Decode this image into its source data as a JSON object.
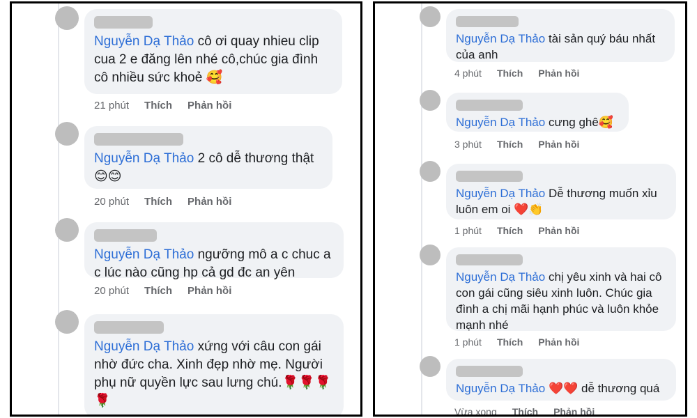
{
  "left_panel": {
    "comments": [
      {
        "author": "Nguyễn Dạ Thảo",
        "text": "cô ơi quay nhieu clip cua 2 e đăng lên nhé cô,chúc gia đình cô nhiều sức khoẻ 🥰",
        "time": "21 phút",
        "like": "Thích",
        "reply": "Phản hồi"
      },
      {
        "author": "Nguyễn Dạ Thảo",
        "text": "2 cô dễ thương thật 😊😊",
        "time": "20 phút",
        "like": "Thích",
        "reply": "Phản hồi"
      },
      {
        "author": "Nguyễn Dạ Thảo",
        "text": "ngưỡng mô a c chuc a c lúc nào cũng hp cả gd đc an yên",
        "time": "20 phút",
        "like": "Thích",
        "reply": "Phản hồi"
      },
      {
        "author": "Nguyễn Dạ Thảo",
        "text": "xứng với câu con gái nhờ đức cha. Xinh đẹp nhờ mẹ. Người phụ nữ quyền lực sau lưng chú.🌹🌹🌹🌹",
        "time": "",
        "like": "",
        "reply": ""
      }
    ]
  },
  "right_panel": {
    "comments": [
      {
        "author": "Nguyễn Dạ Thảo",
        "text": "tài sản quý báu nhất của anh",
        "time": "4 phút",
        "like": "Thích",
        "reply": "Phản hồi"
      },
      {
        "author": "Nguyễn Dạ Thảo",
        "text": "cưng ghê🥰",
        "time": "3 phút",
        "like": "Thích",
        "reply": "Phản hồi"
      },
      {
        "author": "Nguyễn Dạ Thảo",
        "text": "Dễ thương muốn xỉu luôn em oi ❤️👏",
        "time": "1 phút",
        "like": "Thích",
        "reply": "Phản hồi"
      },
      {
        "author": "Nguyễn Dạ Thảo",
        "text": "chị yêu xinh và hai cô con gái cũng siêu xinh luôn. Chúc gia đình a chị mãi hạnh phúc và luôn khỏe mạnh nhé",
        "time": "1 phút",
        "like": "Thích",
        "reply": "Phản hồi"
      },
      {
        "author": "Nguyễn Dạ Thảo",
        "text": "❤️❤️ dễ thương quá",
        "time": "Vừa xong",
        "like": "Thích",
        "reply": "Phản hồi"
      }
    ]
  },
  "colors": {
    "author_link": "#2d6ed6",
    "bubble_bg": "#f0f2f5",
    "meta_text": "#65676b",
    "placeholder_gray": "#c4c4c4"
  }
}
